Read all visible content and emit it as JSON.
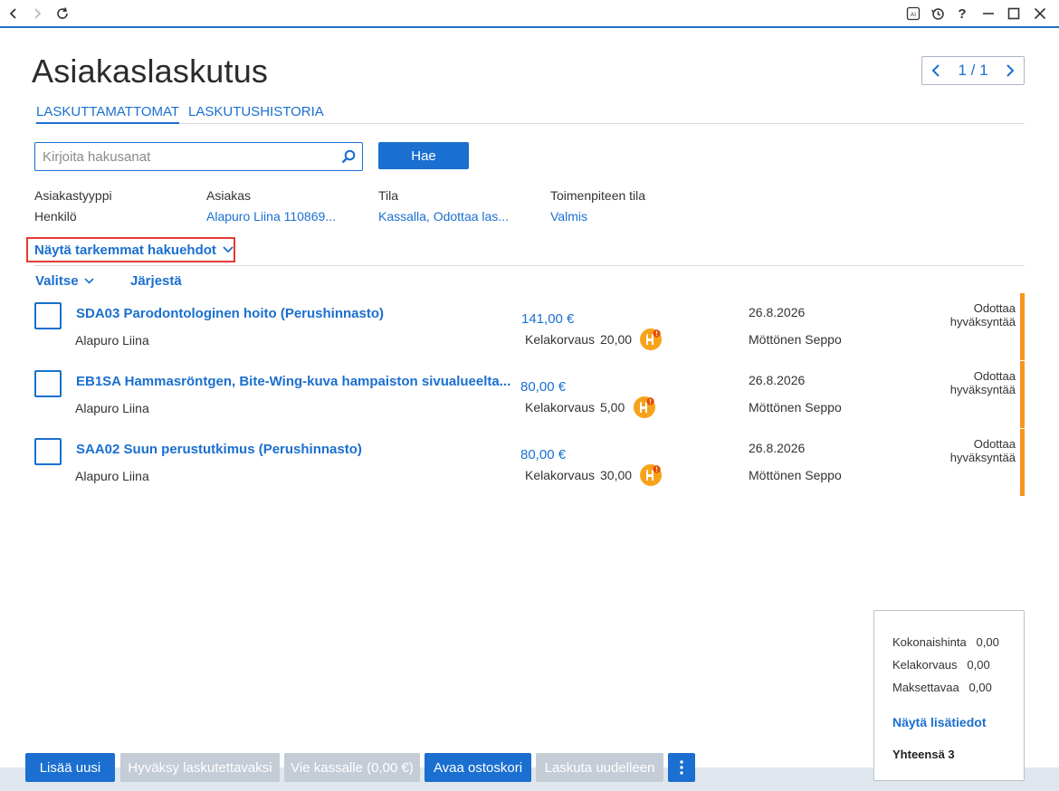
{
  "window": {
    "nav_back_icon": "chevron-left-icon",
    "nav_forward_icon": "chevron-right-icon",
    "refresh_icon": "refresh-icon",
    "right_controls": [
      "ai-icon",
      "history-icon",
      "help-icon",
      "minimize-icon",
      "maximize-icon",
      "close-icon"
    ],
    "help_label": "?",
    "ai_label": "AI"
  },
  "page": {
    "title": "Asiakaslaskutus",
    "pager": {
      "text": "1 / 1"
    }
  },
  "tabs": [
    {
      "label": "LASKUTTAMATTOMAT",
      "active": true
    },
    {
      "label": "LASKUTUSHISTORIA",
      "active": false
    }
  ],
  "search": {
    "placeholder": "Kirjoita hakusanat",
    "value": "",
    "button_label": "Hae"
  },
  "filters": [
    {
      "label": "Asiakastyyppi",
      "value": "Henkilö",
      "link": false
    },
    {
      "label": "Asiakas",
      "value": "Alapuro Liina 110869...",
      "link": true
    },
    {
      "label": "Tila",
      "value": "Kassalla, Odottaa las...",
      "link": true
    },
    {
      "label": "Toimenpiteen tila",
      "value": "Valmis",
      "link": true
    }
  ],
  "more_filters_label": "Näytä tarkemmat hakuehdot",
  "list_actions": {
    "select_label": "Valitse",
    "sort_label": "Järjestä"
  },
  "rows": [
    {
      "title": "SDA03  Parodontologinen hoito (Perushinnasto)",
      "customer": "Alapuro Liina",
      "price": "141,00 €",
      "kela_label": "Kelakorvaus",
      "kela_value": "20,00",
      "date": "26.8.2026",
      "person": "Möttönen Seppo",
      "status_line1": "Odottaa",
      "status_line2": "hyväksyntää",
      "status_color": "#f7941d"
    },
    {
      "title": "EB1SA  Hammasröntgen, Bite-Wing-kuva hampaiston sivualueelta...",
      "customer": "Alapuro Liina",
      "price": "80,00 €",
      "kela_label": "Kelakorvaus",
      "kela_value": "5,00",
      "date": "26.8.2026",
      "person": "Möttönen Seppo",
      "status_line1": "Odottaa",
      "status_line2": "hyväksyntää",
      "status_color": "#f7941d"
    },
    {
      "title": "SAA02  Suun perustutkimus (Perushinnasto)",
      "customer": "Alapuro Liina",
      "price": "80,00 €",
      "kela_label": "Kelakorvaus",
      "kela_value": "30,00",
      "date": "26.8.2026",
      "person": "Möttönen Seppo",
      "status_line1": "Odottaa",
      "status_line2": "hyväksyntää",
      "status_color": "#f7941d"
    }
  ],
  "summary": {
    "total_price_label": "Kokonaishinta",
    "total_price_value": "0,00",
    "kela_label": "Kelakorvaus",
    "kela_value": "0,00",
    "payable_label": "Maksettavaa",
    "payable_value": "0,00",
    "details_link": "Näytä lisätiedot",
    "count_label": "Yhteensä 3"
  },
  "footer_buttons": [
    {
      "label": "Lisää uusi",
      "enabled": true
    },
    {
      "label": "Hyväksy laskutettavaksi",
      "enabled": false
    },
    {
      "label": "Vie kassalle (0,00 €)",
      "enabled": false
    },
    {
      "label": "Avaa ostoskori",
      "enabled": true
    },
    {
      "label": "Laskuta uudelleen",
      "enabled": false
    }
  ],
  "footer_more_icon": "more-vertical-icon",
  "colors": {
    "accent": "#1a6fd0",
    "status_pending": "#f7941d",
    "highlight_border": "#e53935",
    "disabled_button": "#c4ccd6"
  }
}
